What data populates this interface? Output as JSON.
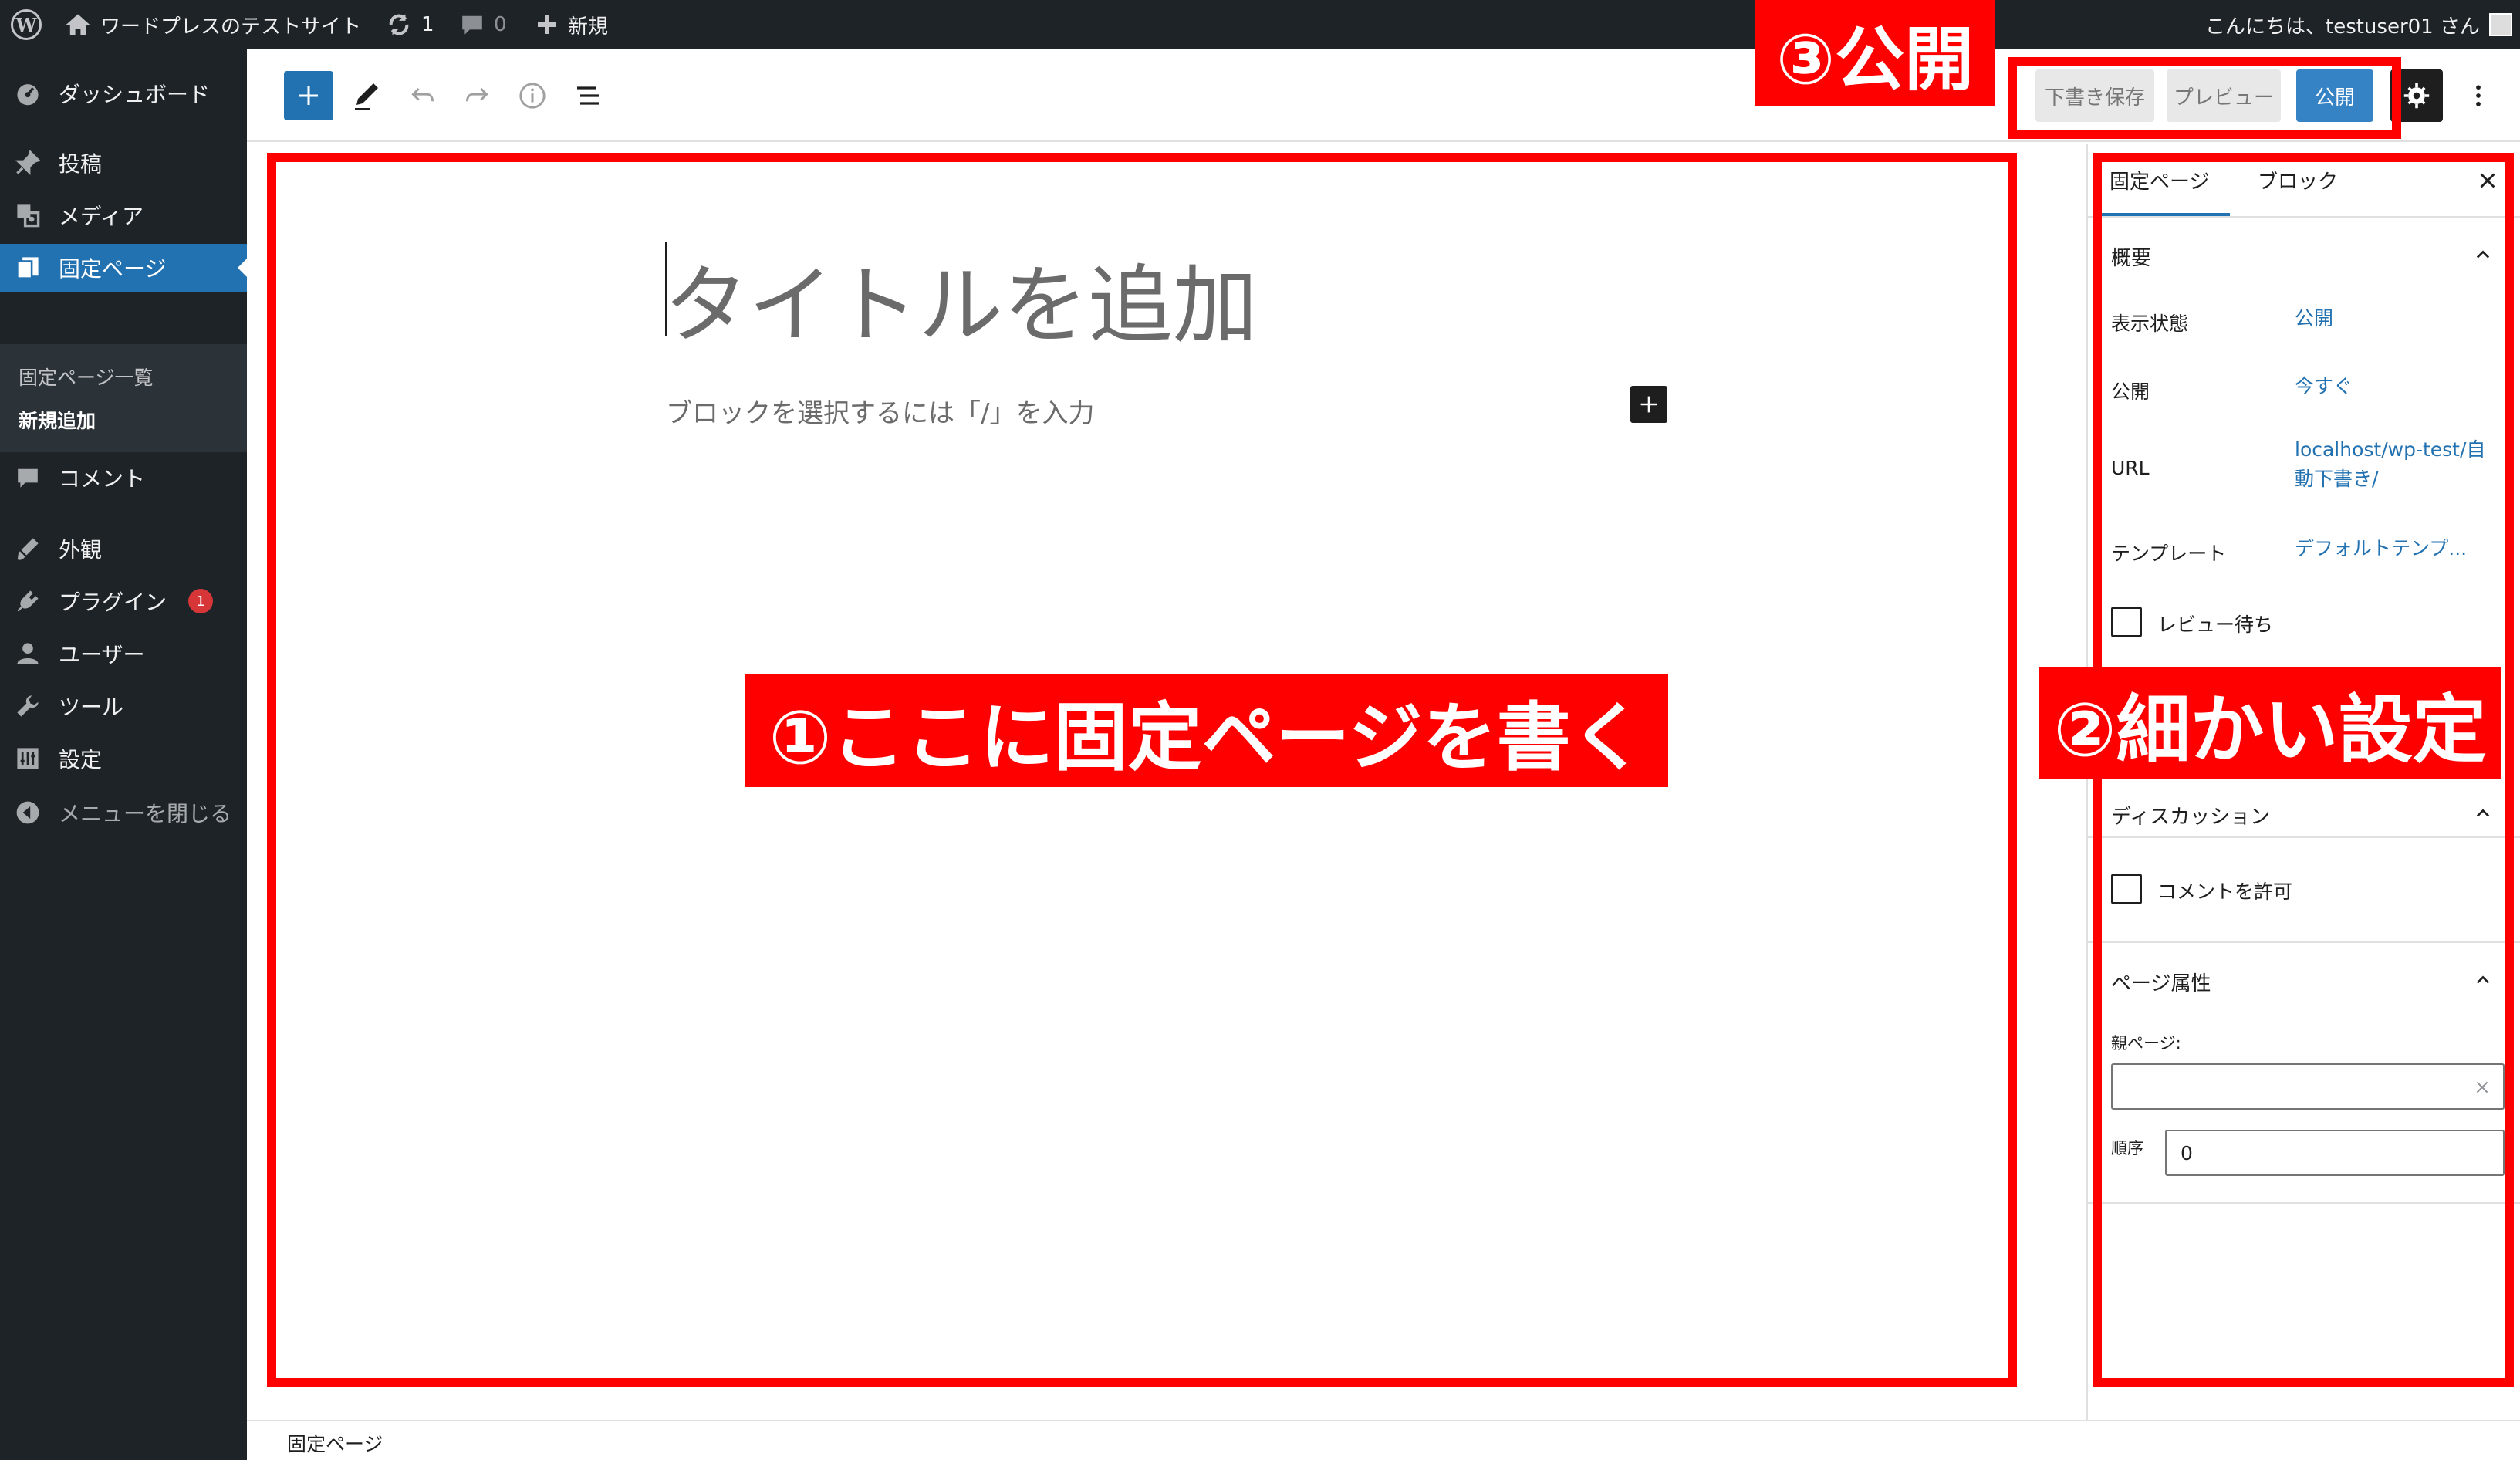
{
  "admin_bar": {
    "site_name": "ワードプレスのテストサイト",
    "updates_count": "1",
    "comments_count": "0",
    "new_label": "新規",
    "greeting": "こんにちは、testuser01 さん"
  },
  "sidebar": {
    "items": [
      {
        "label": "ダッシュボード",
        "icon": "dashboard-icon"
      },
      {
        "label": "投稿",
        "icon": "pin-icon"
      },
      {
        "label": "メディア",
        "icon": "media-icon"
      },
      {
        "label": "固定ページ",
        "icon": "pages-icon"
      },
      {
        "label": "コメント",
        "icon": "comment-icon"
      },
      {
        "label": "外観",
        "icon": "appearance-icon"
      },
      {
        "label": "プラグイン",
        "icon": "plugin-icon"
      },
      {
        "label": "ユーザー",
        "icon": "user-icon"
      },
      {
        "label": "ツール",
        "icon": "wrench-icon"
      },
      {
        "label": "設定",
        "icon": "settings-icon"
      }
    ],
    "submenu": [
      "固定ページ一覧",
      "新規追加"
    ],
    "plugin_badge": "1",
    "collapse_label": "メニューを閉じる"
  },
  "toolbar": {
    "draft_label": "下書き保存",
    "preview_label": "プレビュー",
    "publish_label": "公開"
  },
  "editor": {
    "title_placeholder": "タイトルを追加",
    "block_hint": "ブロックを選択するには「/」を入力"
  },
  "panel": {
    "tabs": [
      "固定ページ",
      "ブロック"
    ],
    "summary_title": "概要",
    "visibility_label": "表示状態",
    "visibility_value": "公開",
    "publish_label": "公開",
    "publish_value": "今すぐ",
    "url_label": "URL",
    "url_value_line1": "localhost/wp-test/自",
    "url_value_line2": "動下書き/",
    "template_label": "テンプレート",
    "template_value": "デフォルトテンプ...",
    "pending_review_label": "レビュー待ち",
    "discussion_title": "ディスカッション",
    "allow_comments_label": "コメントを許可",
    "page_attributes_title": "ページ属性",
    "parent_page_label": "親ページ:",
    "order_label": "順序",
    "order_value": "0"
  },
  "footer": {
    "breadcrumb": "固定ページ"
  },
  "annotations": {
    "editor_label": "①ここに固定ページを書く",
    "settings_label": "②細かい設定",
    "publish_label": "③公開",
    "color": "#ff0000"
  }
}
